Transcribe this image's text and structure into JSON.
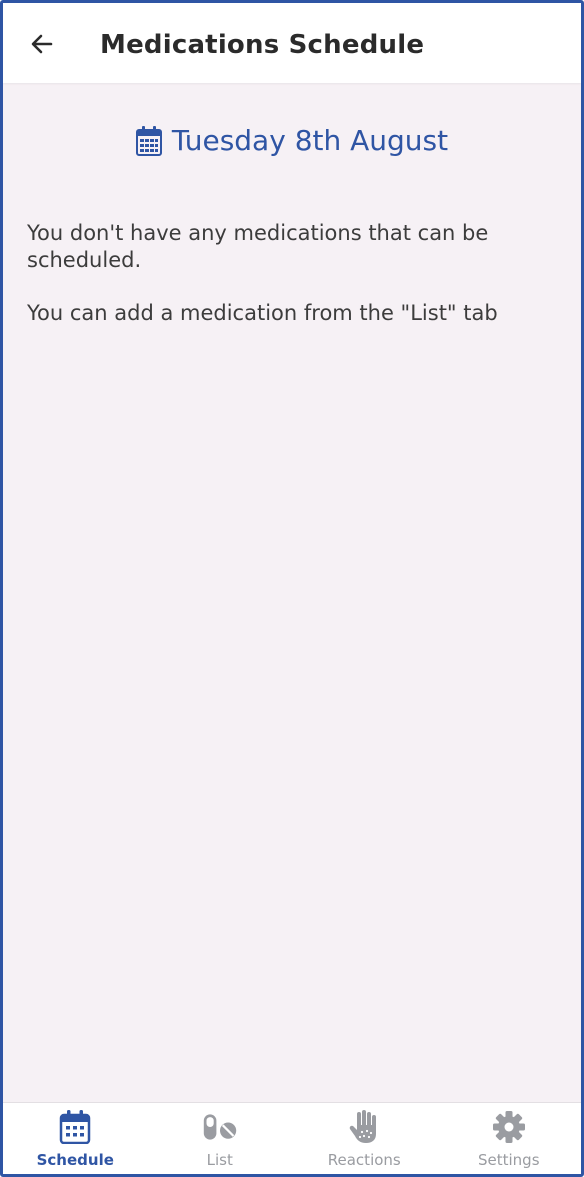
{
  "header": {
    "title": "Medications Schedule",
    "back_icon": "arrow-left-icon"
  },
  "date_selector": {
    "icon": "calendar-icon",
    "label": "Tuesday 8th August"
  },
  "empty_state": {
    "line1": "You don't have any medications that can be scheduled.",
    "line2": "You can add a medication from the \"List\" tab"
  },
  "tabs": [
    {
      "label": "Schedule",
      "icon": "calendar-icon",
      "active": true
    },
    {
      "label": "List",
      "icon": "pills-icon",
      "active": false
    },
    {
      "label": "Reactions",
      "icon": "hand-icon",
      "active": false
    },
    {
      "label": "Settings",
      "icon": "gear-icon",
      "active": false
    }
  ],
  "colors": {
    "accent": "#2f55a4",
    "inactive": "#9a9ca1",
    "background": "#f6f1f5",
    "text": "#3c3c3c"
  }
}
